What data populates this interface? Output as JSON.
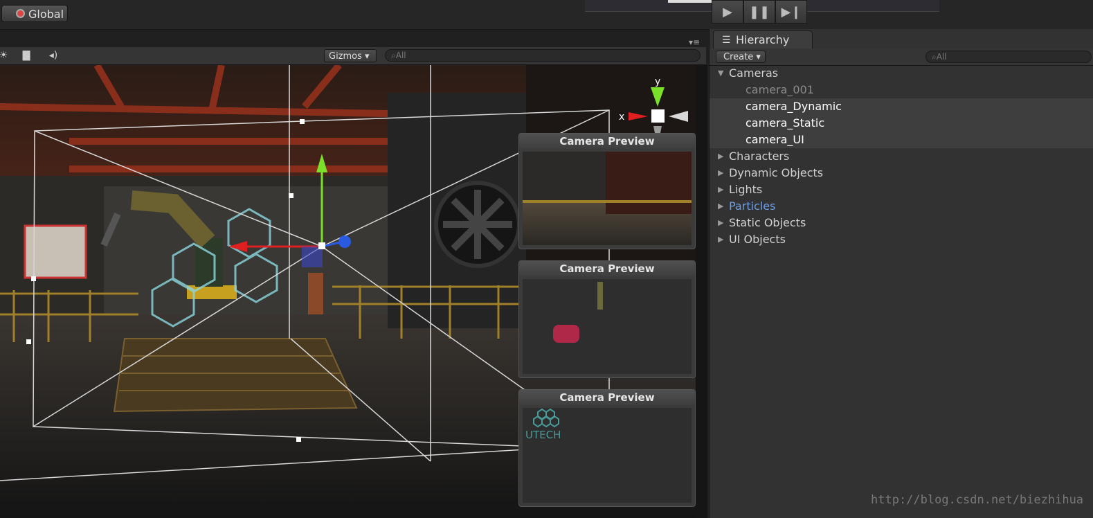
{
  "topbar": {
    "global_label": "Global",
    "play_icons": [
      "play-icon",
      "pause-icon",
      "step-icon"
    ]
  },
  "scene": {
    "toolbar_icons": [
      "sun-icon",
      "image-icon",
      "audio-icon"
    ],
    "gizmos_label": "Gizmos",
    "search_placeholder": "All",
    "axis_labels": {
      "x": "x",
      "y": "y"
    },
    "camera_previews": [
      {
        "title": "Camera Preview"
      },
      {
        "title": "Camera Preview"
      },
      {
        "title": "Camera Preview"
      }
    ],
    "logo_text": "UTECH"
  },
  "hierarchy": {
    "tab_label": "Hierarchy",
    "create_label": "Create",
    "search_placeholder": "All",
    "items": [
      {
        "label": "Cameras",
        "expanded": true
      },
      {
        "label": "camera_001"
      },
      {
        "label": "camera_Dynamic"
      },
      {
        "label": "camera_Static"
      },
      {
        "label": "camera_UI"
      },
      {
        "label": "Characters"
      },
      {
        "label": "Dynamic Objects"
      },
      {
        "label": "Lights"
      },
      {
        "label": "Particles"
      },
      {
        "label": "Static Objects"
      },
      {
        "label": "UI Objects"
      }
    ]
  },
  "watermark": "http://blog.csdn.net/biezhihua",
  "colors": {
    "panel_bg": "#323232",
    "selected_row": "#3e3e3e",
    "particles_blue": "#6c9ee6",
    "axis_x": "#e02020",
    "axis_y": "#7be02a",
    "axis_z": "#2a5ae0"
  }
}
